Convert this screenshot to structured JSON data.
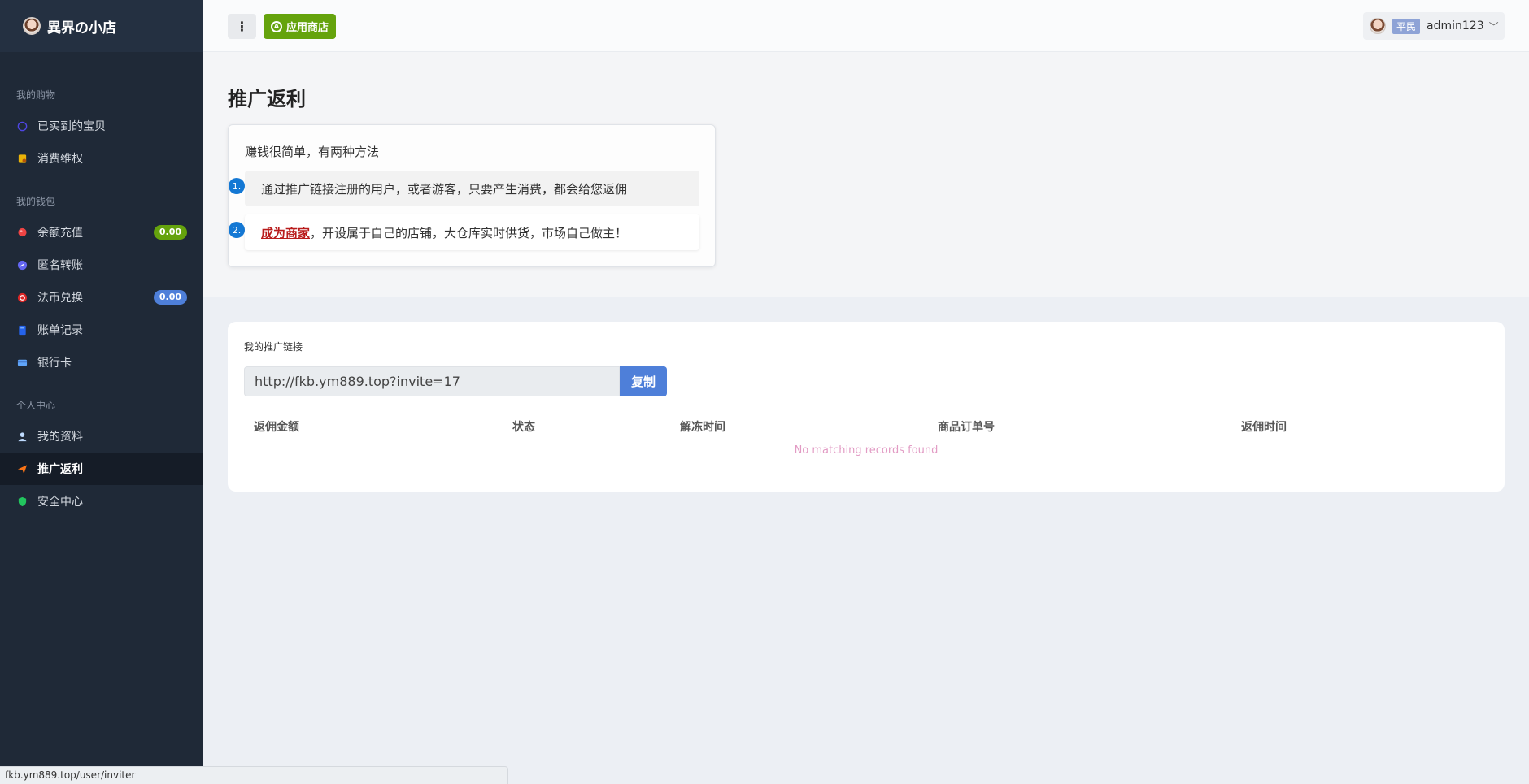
{
  "brand": {
    "name": "異界の小店",
    "logo_icon": "anime-avatar-icon"
  },
  "sidebar": {
    "groups": [
      {
        "title": "我的购物",
        "items": [
          {
            "label": "已买到的宝贝",
            "icon": "bag-icon",
            "icon_color": "#4f46e5"
          },
          {
            "label": "消费维权",
            "icon": "ticket-icon",
            "icon_color": "#eab308"
          }
        ]
      },
      {
        "title": "我的钱包",
        "items": [
          {
            "label": "余额充值",
            "icon": "balloon-icon",
            "icon_color": "#ef4444",
            "badge": "0.00",
            "badge_color": "#65a30d"
          },
          {
            "label": "匿名转账",
            "icon": "transfer-icon",
            "icon_color": "#6366f1"
          },
          {
            "label": "法币兑换",
            "icon": "exchange-icon",
            "icon_color": "#dc2626",
            "badge": "0.00",
            "badge_color": "#4e7fd9"
          },
          {
            "label": "账单记录",
            "icon": "bill-icon",
            "icon_color": "#2563eb"
          },
          {
            "label": "银行卡",
            "icon": "card-icon",
            "icon_color": "#60a5fa"
          }
        ]
      },
      {
        "title": "个人中心",
        "items": [
          {
            "label": "我的资料",
            "icon": "user-icon",
            "icon_color": "#93c5fd"
          },
          {
            "label": "推广返利",
            "icon": "send-icon",
            "icon_color": "#f97316",
            "active": true
          },
          {
            "label": "安全中心",
            "icon": "shield-icon",
            "icon_color": "#22c55e"
          }
        ]
      }
    ]
  },
  "topbar": {
    "menu_icon": "more-vertical-icon",
    "appstore_label": "应用商店",
    "user": {
      "role": "平民",
      "name": "admin123"
    }
  },
  "page": {
    "title": "推广返利",
    "intro": "赚钱很简单，有两种方法",
    "methods": [
      {
        "num": "1.",
        "text": "通过推广链接注册的用户，或者游客，只要产生消费，都会给您返佣"
      },
      {
        "num": "2.",
        "link": "成为商家",
        "text": "，开设属于自己的店铺，大仓库实时供货，市场自己做主！"
      }
    ]
  },
  "referral": {
    "label": "我的推广链接",
    "url": "http://fkb.ym889.top?invite=17",
    "copy_label": "复制",
    "columns": [
      "返佣金额",
      "状态",
      "解冻时间",
      "商品订单号",
      "返佣时间"
    ],
    "empty": "No matching records found"
  },
  "statusbar": {
    "url": "fkb.ym889.top/user/inviter"
  },
  "colors": {
    "sidebar_bg": "#1f2937",
    "accent_green": "#65a30d",
    "accent_blue": "#4e7fd9",
    "link_red": "#b91c1c"
  }
}
